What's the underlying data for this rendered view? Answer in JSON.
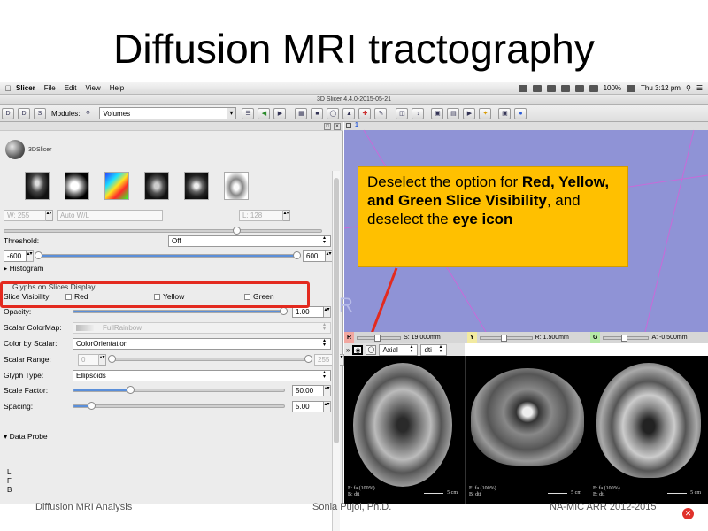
{
  "slide": {
    "title": "Diffusion MRI tractography",
    "footer_left": "Diffusion MRI Analysis",
    "footer_center": "Sonia Pujol, Ph.D.",
    "footer_right": "NA-MIC ARR 2012-2015"
  },
  "mac_menubar": {
    "app": "Slicer",
    "menus": [
      "File",
      "Edit",
      "View",
      "Help"
    ],
    "battery": "100%",
    "clock": "Thu 3:12 pm"
  },
  "window": {
    "title": "3D Slicer 4.4.0-2015-05-21"
  },
  "toolbar": {
    "modules_label": "Modules:",
    "module_selected": "Volumes"
  },
  "left_panel": {
    "logo_text": "3DSlicer",
    "window_label": "W: 255",
    "auto_wl": "Auto W/L",
    "level_label": "L: 128",
    "threshold_label": "Threshold:",
    "threshold_value": "Off",
    "range_min": "-600",
    "range_max": "600",
    "histogram": "Histogram",
    "glyphs_section": "Glyphs on Slices Display",
    "slice_visibility_label": "Slice Visibility:",
    "slice_options": [
      "Red",
      "Yellow",
      "Green"
    ],
    "opacity_label": "Opacity:",
    "opacity_value": "1.00",
    "opacity_level": 1.0,
    "scalar_colormap_label": "Scalar ColorMap:",
    "scalar_colormap_value": "FullRainbow",
    "color_by_scalar_label": "Color by Scalar:",
    "color_by_scalar_value": "ColorOrientation",
    "scalar_range_label": "Scalar Range:",
    "scalar_range_min": "0",
    "scalar_range_max": "255",
    "glyph_type_label": "Glyph Type:",
    "glyph_type_value": "Ellipsoids",
    "scale_factor_label": "Scale Factor:",
    "scale_factor_value": "50.00",
    "spacing_label": "Spacing:",
    "spacing_value": "5.00",
    "data_probe": "Data Probe",
    "orientation_letters": [
      "L",
      "F",
      "B"
    ]
  },
  "view3d": {
    "tab_number": "1",
    "orientation_letter": "R"
  },
  "callout": {
    "text_part1": "Deselect the option for ",
    "text_bold1": "Red, Yellow, and Green  Slice Visibility",
    "text_part2": ", and deselect the ",
    "text_bold2": "eye icon"
  },
  "slice_views": {
    "red": {
      "tag": "R",
      "offset": "S: 19.000mm"
    },
    "yellow": {
      "tag": "Y",
      "offset": "R: 1.500mm"
    },
    "green": {
      "tag": "G",
      "offset": "A: -0.500mm"
    },
    "orientation": "Axial",
    "volume": "dti",
    "info_f": "F: fa (100%)",
    "info_b": "B: dti",
    "scale": "5 cm"
  },
  "colors": {
    "callout_bg": "#ffc000",
    "highlight_box": "#e32a1f",
    "view3d_bg": "#8f93d6"
  }
}
